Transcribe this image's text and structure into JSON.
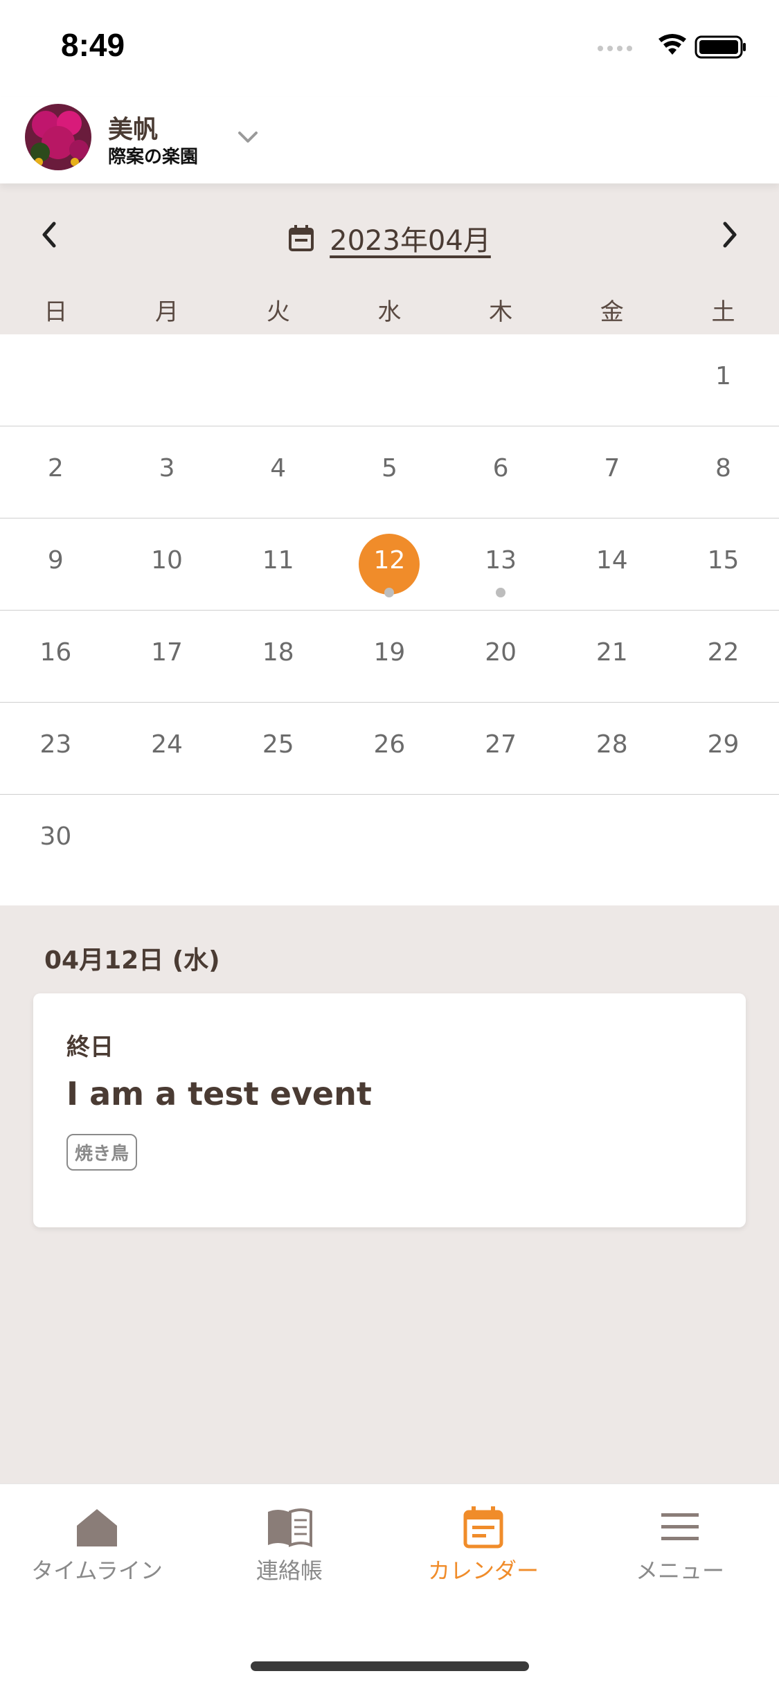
{
  "status_bar": {
    "time": "8:49"
  },
  "header": {
    "child_name": "美帆",
    "school_name": "際案の楽園"
  },
  "calendar": {
    "month_label": "2023年04月",
    "weekdays": [
      "日",
      "月",
      "火",
      "水",
      "木",
      "金",
      "土"
    ],
    "weeks": [
      [
        "",
        "",
        "",
        "",
        "",
        "",
        "1"
      ],
      [
        "2",
        "3",
        "4",
        "5",
        "6",
        "7",
        "8"
      ],
      [
        "9",
        "10",
        "11",
        "12",
        "13",
        "14",
        "15"
      ],
      [
        "16",
        "17",
        "18",
        "19",
        "20",
        "21",
        "22"
      ],
      [
        "23",
        "24",
        "25",
        "26",
        "27",
        "28",
        "29"
      ],
      [
        "30",
        "",
        "",
        "",
        "",
        "",
        ""
      ]
    ],
    "selected_day": "12",
    "event_dots": [
      "12",
      "13"
    ]
  },
  "selected_date": {
    "title": "04月12日 (水)",
    "event": {
      "time_label": "終日",
      "title": "I am a test event",
      "tag": "焼き鳥"
    }
  },
  "tabbar": {
    "items": [
      {
        "label": "タイムライン",
        "icon": "home-icon"
      },
      {
        "label": "連絡帳",
        "icon": "book-icon"
      },
      {
        "label": "カレンダー",
        "icon": "calendar-icon"
      },
      {
        "label": "メニュー",
        "icon": "menu-icon"
      }
    ],
    "active_index": 2
  },
  "colors": {
    "accent": "#f08c2a",
    "brown": "#4a3b33",
    "panel": "#ede8e6"
  }
}
